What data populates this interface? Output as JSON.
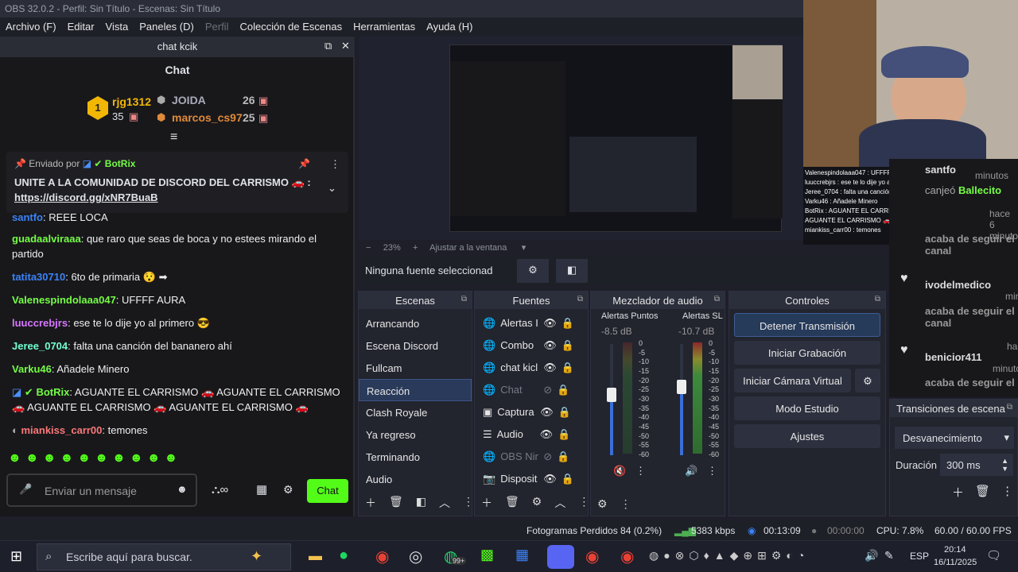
{
  "titlebar": "OBS 32.0.2 - Perfil: Sin Título - Escenas: Sin Título",
  "menu": [
    "Archivo (F)",
    "Editar",
    "Vista",
    "Paneles (D)",
    "Perfil",
    "Colección de Escenas",
    "Herramientas",
    "Ayuda (H)"
  ],
  "chat": {
    "dock_title": "chat kcik",
    "header": "Chat",
    "leaders": [
      {
        "rank": "1",
        "name": "rjg1312",
        "points": "35"
      },
      {
        "name": "JOIDA",
        "points": "26"
      },
      {
        "name": "marcos_cs97",
        "points": "25"
      }
    ],
    "pinned": {
      "by": "Enviado por",
      "bot": "BotRix",
      "text": "UNITE A LA COMUNIDAD DE DISCORD DEL CARRISMO 🚗 :",
      "link": "https://discord.gg/xNR7BuaB"
    },
    "messages": [
      {
        "user": "santfo",
        "text": "REEE LOCA",
        "color": "#3b82f6"
      },
      {
        "user": "guadaalviraaa",
        "text": "que raro que seas de boca y no estees mirando el partido",
        "color": "#75fd46"
      },
      {
        "user": "tatita30710",
        "text": "6to de primaria 😯 ➡",
        "color": "#3b82f6"
      },
      {
        "user": "Valenespindolaaa047",
        "text": "UFFFF AURA",
        "color": "#75fd46"
      },
      {
        "user": "luuccrebjrs",
        "text": "ese te lo dije yo al primero 😎",
        "color": "#d778ff"
      },
      {
        "user": "Jeree_0704",
        "text": "falta una canción del bananero ahí",
        "color": "#72ffd0"
      },
      {
        "user": "Varku46",
        "text": "Añadele Minero",
        "color": "#75fd46"
      },
      {
        "user": "BotRix",
        "text": "AGUANTE EL CARRISMO 🚗 AGUANTE EL CARRISMO 🚗 AGUANTE EL CARRISMO 🚗 AGUANTE EL CARRISMO 🚗",
        "color": "#75fd46"
      },
      {
        "user": "miankiss_carr00",
        "text": "temones",
        "color": "#fa7878"
      }
    ],
    "input_placeholder": "Enviar un mensaje",
    "send": "Chat"
  },
  "preview": {
    "zoom": "23%",
    "fit": "Ajustar a la ventana"
  },
  "source_bar": {
    "label": "Ninguna fuente seleccionad"
  },
  "scenes": {
    "title": "Escenas",
    "items": [
      "Arrancando",
      "Escena Discord",
      "Fullcam",
      "Reacción",
      "Clash Royale",
      "Ya regreso",
      "Terminando",
      "Audio"
    ],
    "selected": 3
  },
  "sources": {
    "title": "Fuentes",
    "items": [
      {
        "name": "Alertas I",
        "icon": "globe",
        "visible": true
      },
      {
        "name": "Combo",
        "icon": "globe",
        "visible": true
      },
      {
        "name": "chat kicl",
        "icon": "globe",
        "visible": true
      },
      {
        "name": "Chat",
        "icon": "globe",
        "visible": false
      },
      {
        "name": "Captura",
        "icon": "window",
        "visible": true
      },
      {
        "name": "Audio",
        "icon": "list",
        "visible": true
      },
      {
        "name": "OBS Nin",
        "icon": "globe",
        "visible": false
      },
      {
        "name": "Disposit",
        "icon": "camera",
        "visible": true
      }
    ]
  },
  "mixer": {
    "title": "Mezclador de audio",
    "channels": [
      {
        "name": "Alertas Puntos",
        "db": "-8.5 dB",
        "level": 0.55,
        "muted": true
      },
      {
        "name": "Alertas SL",
        "db": "-10.7 dB",
        "level": 0.62,
        "muted": false
      }
    ],
    "scale": [
      "0",
      "-5",
      "-10",
      "-15",
      "-20",
      "-25",
      "-30",
      "-35",
      "-40",
      "-45",
      "-50",
      "-55",
      "-60"
    ]
  },
  "controls": {
    "title": "Controles",
    "buttons": [
      "Detener Transmisión",
      "Iniciar Grabación",
      "Iniciar Cámara Virtual",
      "Modo Estudio",
      "Ajustes"
    ]
  },
  "transitions": {
    "title": "Transiciones de escena",
    "selected": "Desvanecimiento",
    "duration_label": "Duración",
    "duration": "300 ms"
  },
  "right_chat": [
    {
      "user": "santfo",
      "line": "minutos"
    },
    {
      "user": "",
      "line": "canjeó",
      "extra": "Ballecito"
    },
    {
      "user": "",
      "line": "hace 6 minutos"
    },
    {
      "user": "",
      "line": "acaba de seguir el canal"
    },
    {
      "user": "ivodelmedico",
      "line": "mir"
    },
    {
      "user": "",
      "line": "acaba de seguir el canal"
    },
    {
      "user": "benicior411",
      "line": "hac"
    },
    {
      "user": "",
      "line": "minuto"
    },
    {
      "user": "",
      "line": "acaba de seguir el"
    }
  ],
  "cam_overlay": [
    "Valenespindolaaa047 : UFFFF AURA",
    "luuccrebjrs : ese te lo dije yo al primero 😎",
    "Jeree_0704 : falta una canción del bananero ahí",
    "Varku46 : Añadele Minero",
    "BotRix : AGUANTE EL CARRISMO 🚗 AGUANTE EL CARRISMO 🚗 AGUANTE EL CARRISMO 🚗 AGUANTE EL CARRISMO 🚗",
    "miankiss_carr00 : temones"
  ],
  "status": {
    "frames": "Fotogramas Perdidos 84 (0.2%)",
    "kbps": "5383 kbps",
    "stream_time": "00:13:09",
    "rec_time": "00:00:00",
    "cpu": "CPU: 7.8%",
    "fps": "60.00 / 60.00 FPS"
  },
  "taskbar": {
    "search": "Escribe aquí para buscar.",
    "lang": "ESP",
    "time": "20:14",
    "date": "16/11/2025",
    "badge": "99+"
  },
  "colors": {
    "accent": "#53fc18",
    "selection": "#2a3a5a",
    "meter_green": "#4caf50",
    "meter_blue": "#3a6fd8"
  }
}
